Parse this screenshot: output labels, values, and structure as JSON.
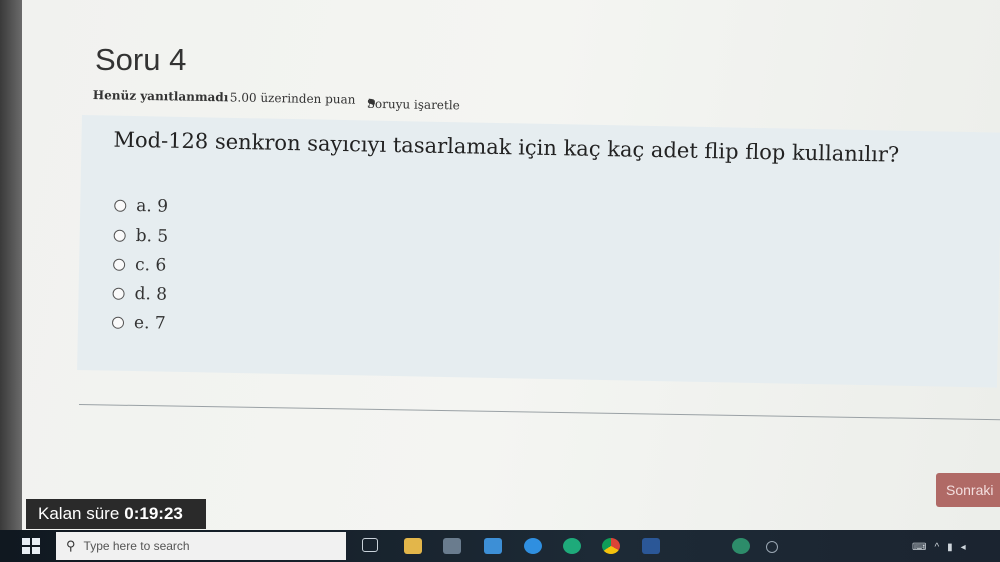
{
  "question": {
    "title": "Soru 4",
    "status": "Henüz yanıtlanmadı",
    "points": "5.00 üzerinden puan",
    "flag_label": "Soruyu işaretle",
    "text": "Mod-128 senkron sayıcıyı tasarlamak için kaç kaç adet flip flop kullanılır?",
    "answers": [
      {
        "label": "a. 9"
      },
      {
        "label": "b. 5"
      },
      {
        "label": "c. 6"
      },
      {
        "label": "d. 8"
      },
      {
        "label": "e. 7"
      }
    ]
  },
  "navigation": {
    "next_label": "Sonraki"
  },
  "timer": {
    "label": "Kalan süre",
    "value": "0:19:23"
  },
  "taskbar": {
    "search_placeholder": "Type here to search",
    "icons": [
      "task-view-icon",
      "file-explorer-icon",
      "store-icon",
      "mail-icon",
      "edge-legacy-icon",
      "edge-icon",
      "chrome-icon",
      "word-icon",
      "maps-icon",
      "people-icon"
    ]
  },
  "colors": {
    "question_bg": "#e6edf0",
    "next_button": "#b06a66",
    "timer_bg": "#2a2a2a",
    "taskbar_bg": "#1b2430"
  }
}
